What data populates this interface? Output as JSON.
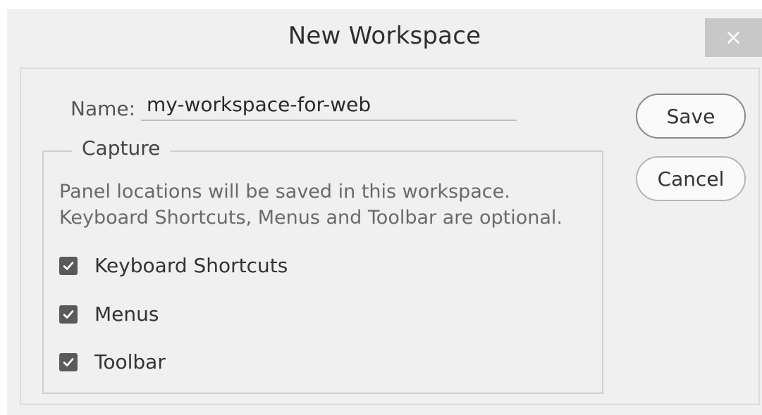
{
  "dialog": {
    "title": "New Workspace",
    "close_glyph": "×"
  },
  "name_field": {
    "label": "Name:",
    "value": "my-workspace-for-web"
  },
  "capture": {
    "legend": "Capture",
    "description_line1": "Panel locations will be saved in this workspace.",
    "description_line2": "Keyboard Shortcuts, Menus and Toolbar are optional.",
    "options": [
      {
        "label": "Keyboard Shortcuts",
        "checked": true
      },
      {
        "label": "Menus",
        "checked": true
      },
      {
        "label": "Toolbar",
        "checked": true
      }
    ]
  },
  "buttons": {
    "save": "Save",
    "cancel": "Cancel"
  },
  "colors": {
    "dialog_bg": "#f0f0f0",
    "checkbox_fill": "#5a5a5a",
    "close_bg": "#c8c8c8"
  },
  "icons": {
    "close": "close-icon",
    "check": "checkmark-icon"
  }
}
